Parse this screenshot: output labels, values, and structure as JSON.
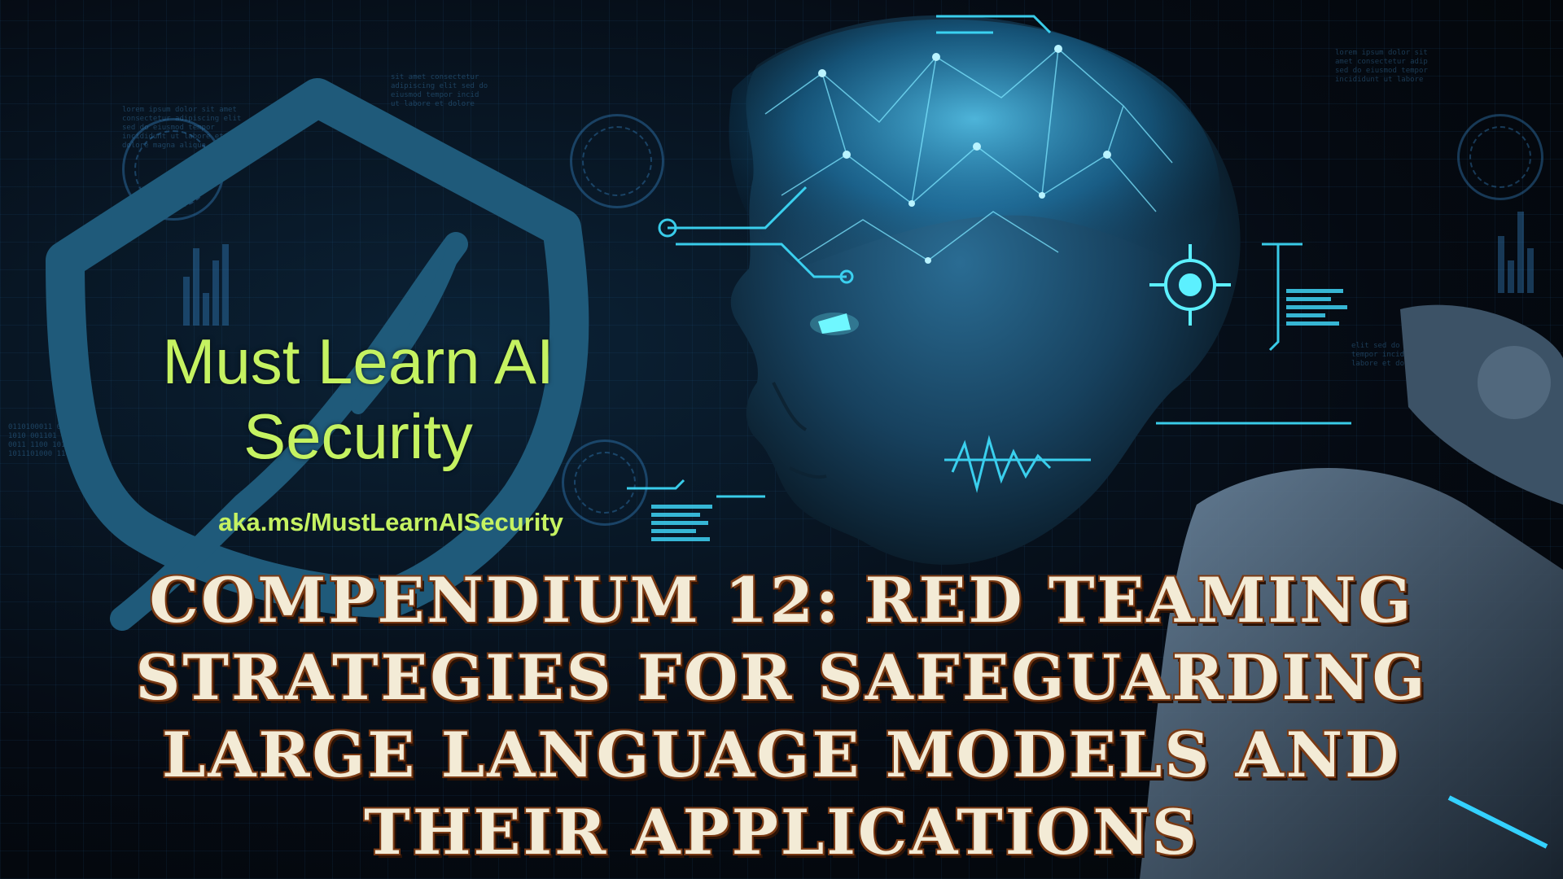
{
  "brand": {
    "title_line1": "Must Learn AI",
    "title_line2": "Security",
    "link": "aka.ms/MustLearnAISecurity",
    "accent_color": "#c5f261",
    "shield_color": "#1f5a7a"
  },
  "headline": {
    "lines": [
      "Compendium 12: Red Teaming",
      "Strategies for Safeguarding",
      "Large Language Models and",
      "Their Applications"
    ],
    "color": "#f3ebd6",
    "outline_color": "#7a3a14"
  },
  "imagery": {
    "background": "circuit-hud-icon",
    "figure": "robot-head-icon",
    "logo": "shield-icon"
  }
}
